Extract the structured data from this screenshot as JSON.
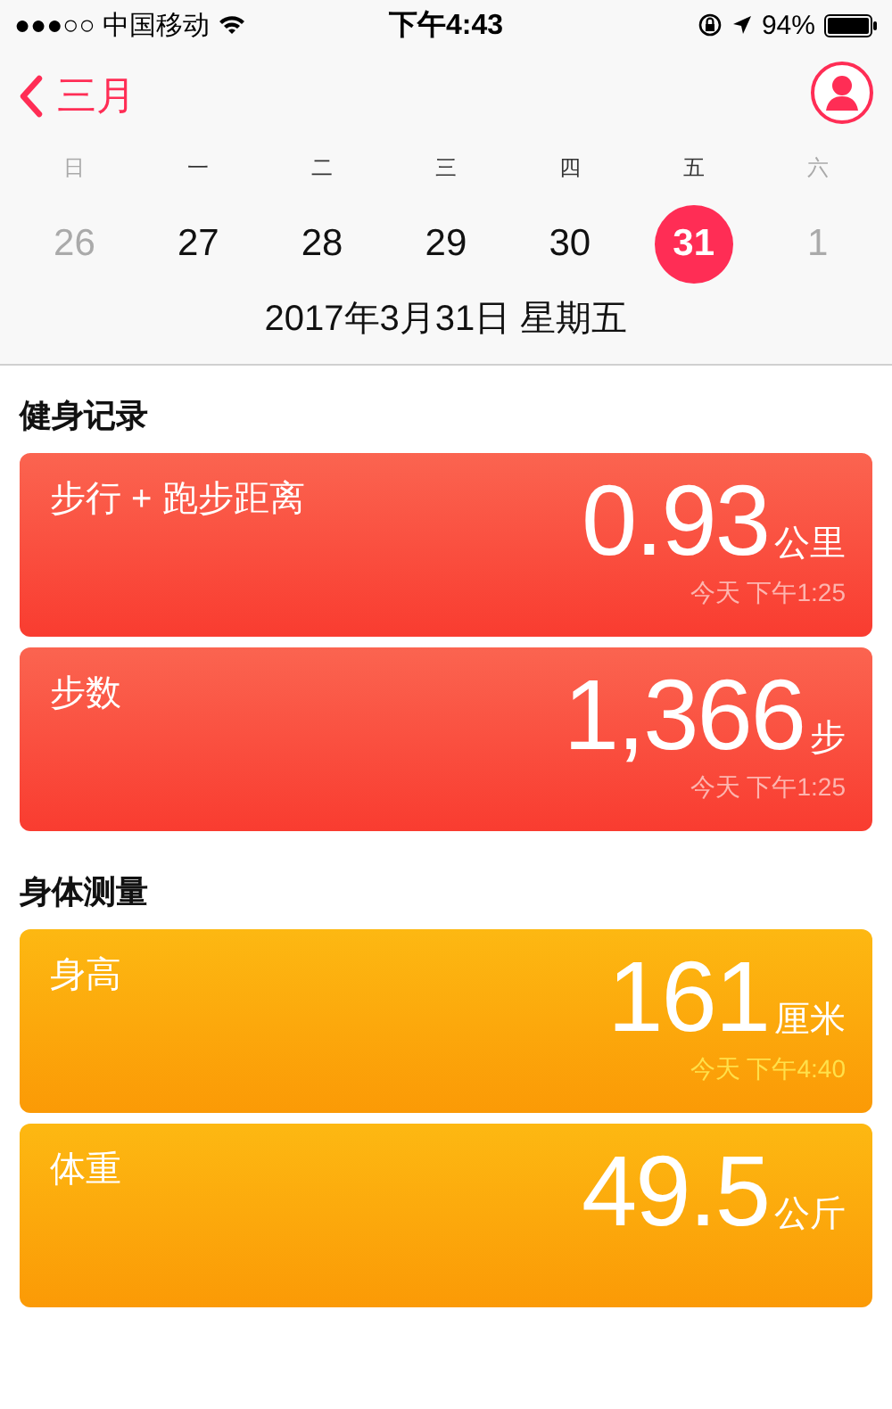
{
  "status_bar": {
    "carrier": "●●●○○ 中国移动",
    "time": "下午4:43",
    "battery_text": "94%"
  },
  "nav": {
    "back_label": "三月"
  },
  "week": [
    {
      "label": "日",
      "muted": true
    },
    {
      "label": "一",
      "muted": false
    },
    {
      "label": "二",
      "muted": false
    },
    {
      "label": "三",
      "muted": false
    },
    {
      "label": "四",
      "muted": false
    },
    {
      "label": "五",
      "muted": false
    },
    {
      "label": "六",
      "muted": true
    }
  ],
  "days": [
    {
      "label": "26",
      "muted": true,
      "selected": false
    },
    {
      "label": "27",
      "muted": false,
      "selected": false
    },
    {
      "label": "28",
      "muted": false,
      "selected": false
    },
    {
      "label": "29",
      "muted": false,
      "selected": false
    },
    {
      "label": "30",
      "muted": false,
      "selected": false
    },
    {
      "label": "31",
      "muted": false,
      "selected": true
    },
    {
      "label": "1",
      "muted": true,
      "selected": false
    }
  ],
  "selected_date": "2017年3月31日 星期五",
  "sections": [
    {
      "title": "健身记录",
      "kind": "activity",
      "cards": [
        {
          "title": "步行 + 跑步距离",
          "value": "0.93",
          "unit": "公里",
          "time": "今天 下午1:25"
        },
        {
          "title": "步数",
          "value": "1,366",
          "unit": "步",
          "time": "今天 下午1:25"
        }
      ]
    },
    {
      "title": "身体测量",
      "kind": "body",
      "cards": [
        {
          "title": "身高",
          "value": "161",
          "unit": "厘米",
          "time": "今天 下午4:40"
        },
        {
          "title": "体重",
          "value": "49.5",
          "unit": "公斤"
        }
      ]
    }
  ]
}
